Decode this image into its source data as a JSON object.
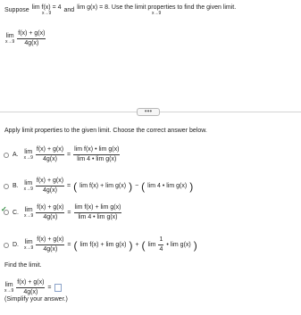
{
  "question": {
    "intro": "Suppose",
    "lim1_expr": "lim f(x) = 4",
    "lim_sub": "x→9",
    "and": "and",
    "lim2_expr": "lim g(x) = 8. Use the limit properties to find the given limit.",
    "target_lim": "lim",
    "target_num": "f(x) + g(x)",
    "target_den": "4g(x)"
  },
  "more_button_label": "•••",
  "prompt": "Apply limit properties to the given limit. Choose the correct answer below.",
  "options": [
    {
      "letter": "A.",
      "lhs_num": "f(x) + g(x)",
      "lhs_den": "4g(x)",
      "rhs_num": "lim f(x) • lim g(x)",
      "rhs_den": "lim 4 • lim g(x)",
      "selected": false
    },
    {
      "letter": "B.",
      "lhs_num": "f(x) + g(x)",
      "lhs_den": "4g(x)",
      "rhs_part1": "lim f(x) + lim g(x)",
      "minus": "−",
      "rhs_part2": "lim 4 • lim g(x)",
      "selected": false
    },
    {
      "letter": "C.",
      "lhs_num": "f(x) + g(x)",
      "lhs_den": "4g(x)",
      "rhs_num": "lim f(x) + lim g(x)",
      "rhs_den": "lim 4 • lim g(x)",
      "selected": true
    },
    {
      "letter": "D.",
      "lhs_num": "f(x) + g(x)",
      "lhs_den": "4g(x)",
      "rhs_part1": "lim f(x) + lim g(x)",
      "plus": "+",
      "rhs_part2_lim": "lim",
      "rhs_part2_num": "1",
      "rhs_part2_den": "4",
      "rhs_part2_tail": "• lim g(x)",
      "selected": false
    }
  ],
  "find": {
    "label": "Find the limit.",
    "lim": "lim",
    "num": "f(x) + g(x)",
    "den": "4g(x)",
    "equals": "=",
    "answer_value": "",
    "hint": "(Simplify your answer.)"
  },
  "eq": "=",
  "check_symbol": "✓",
  "colors": {
    "selected_check": "#2e8b3e",
    "answer_border": "#8aa2c8",
    "divider": "#d4d4d4"
  }
}
